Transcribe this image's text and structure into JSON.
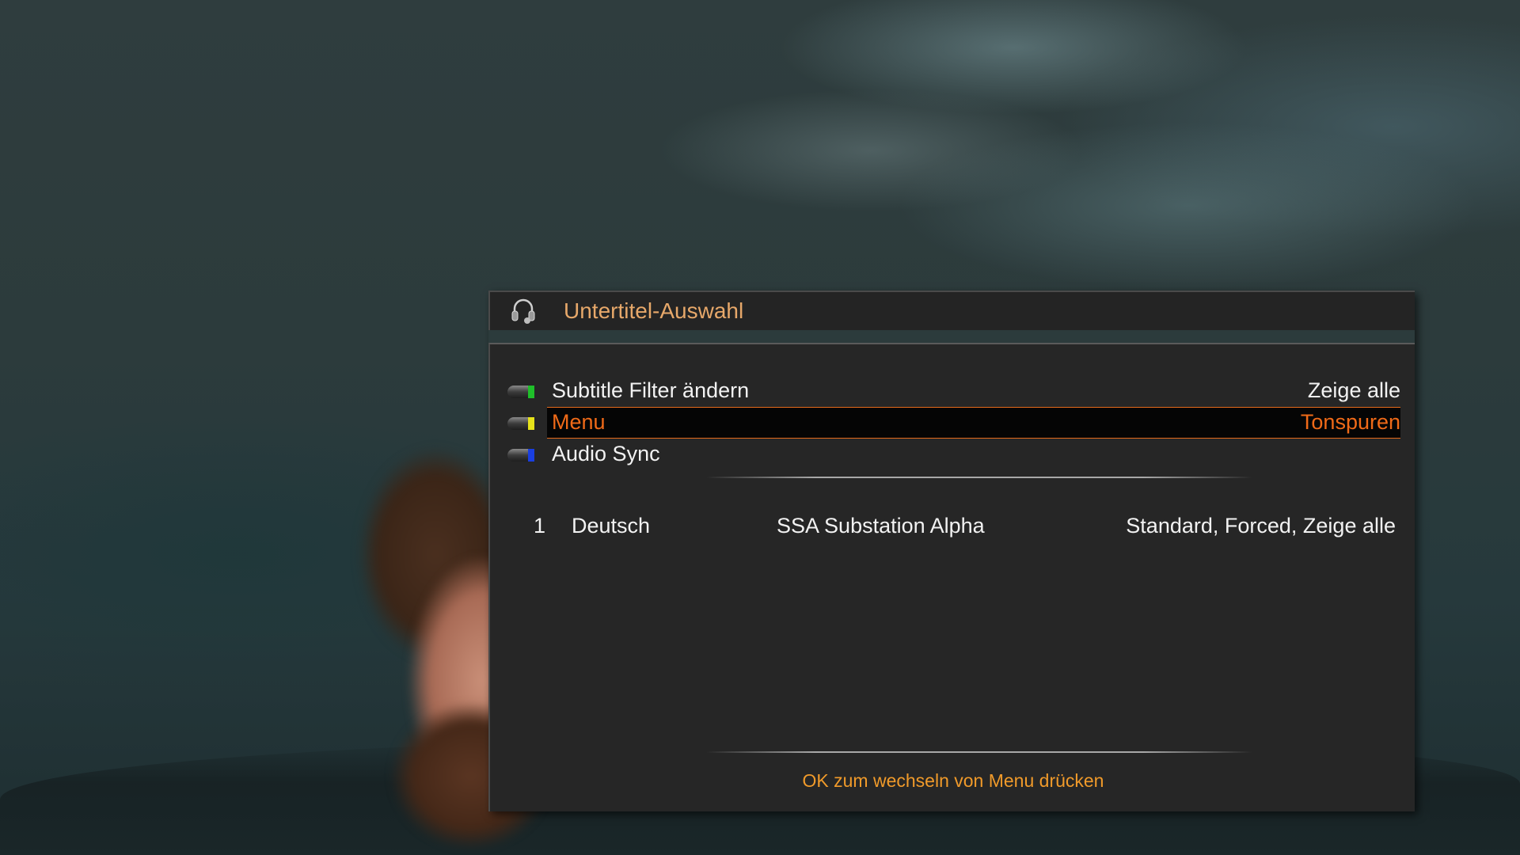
{
  "dialog": {
    "title": "Untertitel-Auswahl",
    "icon": "headphones-icon"
  },
  "menu": [
    {
      "label": "Subtitle Filter ändern",
      "value": "Zeige alle",
      "button_color": "#1fbf2a",
      "button": "green-button-icon",
      "selected": false
    },
    {
      "label": "Menu",
      "value": "Tonspuren",
      "button_color": "#e6e21a",
      "button": "yellow-button-icon",
      "selected": true
    },
    {
      "label": "Audio Sync",
      "value": "",
      "button_color": "#1a3fe0",
      "button": "blue-button-icon",
      "selected": false
    }
  ],
  "tracks": [
    {
      "number": "1",
      "language": "Deutsch",
      "codec": "SSA Substation Alpha",
      "flags": "Standard, Forced, Zeige alle"
    }
  ],
  "footer": {
    "hint": "OK zum wechseln von Menu drücken"
  },
  "colors": {
    "title": "#e7a86a",
    "highlight_text": "#f06a18",
    "hint": "#f09a2a"
  }
}
